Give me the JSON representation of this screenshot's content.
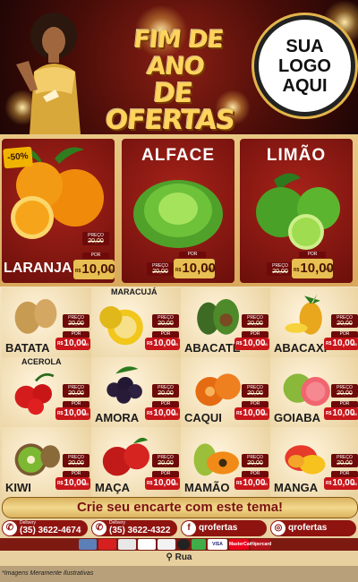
{
  "header": {
    "headline_line1": "FIM DE ANO",
    "headline_line2": "DE OFERTAS",
    "logo_lines": [
      "SUA",
      "LOGO",
      "AQUI"
    ]
  },
  "price_labels": {
    "preco": "PREÇO",
    "por": "POR",
    "currency": "R$",
    "kg": "KG",
    "und": "UND"
  },
  "featured": [
    {
      "name": "LARANJA",
      "old_price": "20,00",
      "price": "10,00",
      "unit": "KG",
      "badge": "-50%"
    },
    {
      "name": "ALFACE",
      "old_price": "20,00",
      "price": "10,00",
      "unit": "UND"
    },
    {
      "name": "LIMÃO",
      "old_price": "20,00",
      "price": "10,00",
      "unit": "KG"
    }
  ],
  "products": [
    {
      "name": "BATATA",
      "old_price": "20,00",
      "price": "10,00",
      "unit": "KG"
    },
    {
      "name": "MARACUJÁ",
      "old_price": "20,00",
      "price": "10,00",
      "unit": "KG"
    },
    {
      "name": "ABACATE",
      "old_price": "20,00",
      "price": "10,00",
      "unit": "KG"
    },
    {
      "name": "ABACAXI",
      "old_price": "20,00",
      "price": "10,00",
      "unit": "KG"
    },
    {
      "name": "ACEROLA",
      "old_price": "20,00",
      "price": "10,00",
      "unit": "KG"
    },
    {
      "name": "AMORA",
      "old_price": "20,00",
      "price": "10,00",
      "unit": "KG"
    },
    {
      "name": "CAQUI",
      "old_price": "20,00",
      "price": "10,00",
      "unit": "KG"
    },
    {
      "name": "GOIABA",
      "old_price": "20,00",
      "price": "10,00",
      "unit": "KG"
    },
    {
      "name": "KIWI",
      "old_price": "20,00",
      "price": "10,00",
      "unit": "KG"
    },
    {
      "name": "MAÇA",
      "old_price": "20,00",
      "price": "10,00",
      "unit": "KG"
    },
    {
      "name": "MAMÃO",
      "old_price": "20,00",
      "price": "10,00",
      "unit": "KG"
    },
    {
      "name": "MANGA",
      "old_price": "20,00",
      "price": "10,00",
      "unit": "KG"
    }
  ],
  "cta": "Crie seu encarte com este tema!",
  "contacts": [
    {
      "label": "Delivery",
      "text": "(35) 3622-4674",
      "icon": "phone-icon"
    },
    {
      "label": "Delivery",
      "text": "(35) 3622-4322",
      "icon": "phone-icon"
    },
    {
      "label": "",
      "text": "qrofertas",
      "icon": "facebook-icon"
    },
    {
      "label": "",
      "text": "qrofertas",
      "icon": "instagram-icon"
    }
  ],
  "payment_labels": [
    "VISA",
    "MasterCard",
    "Hipercard"
  ],
  "address": "Rua",
  "disclaimer": "*Imagens Meramente Ilustrativas",
  "colors": {
    "brand_red": "#8f1410",
    "price_red": "#c8161b",
    "gold": "#e3b54a"
  }
}
